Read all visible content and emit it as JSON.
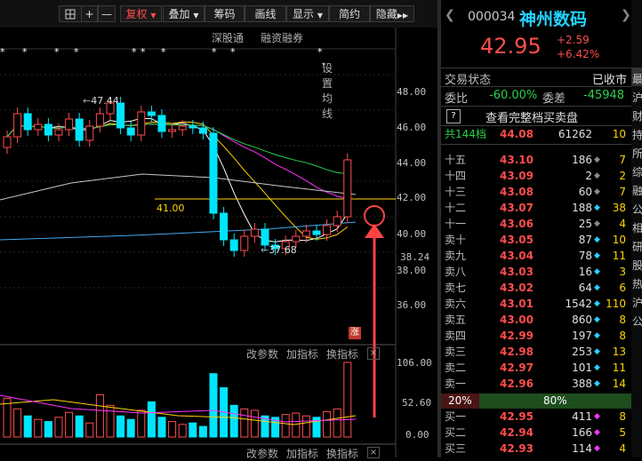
{
  "toolbar": {
    "plus": "+",
    "minus": "—",
    "fuquan": "复权",
    "diejia": "叠加",
    "chouma": "筹码",
    "huaxian": "画线",
    "xianshi": "显示",
    "jianyue": "简约",
    "yincang": "隐藏"
  },
  "sublinks": {
    "shengutong": "深股通",
    "rongzi": "融资融券",
    "junxian": "设置均线"
  },
  "price_axis": [
    "48.00",
    "46.00",
    "44.00",
    "42.00",
    "40.00",
    "38.24",
    "38.00",
    "36.00"
  ],
  "annotations": {
    "high": "47.44",
    "low": "37.68",
    "ref_price": "41.00",
    "zhang": "涨"
  },
  "indicator_bar": {
    "gaicanshu": "改参数",
    "jiazhibiao": "加指标",
    "huanzhibiao": "换指标",
    "close": "×"
  },
  "volume_axis": [
    "106.00",
    "52.60",
    "0.00"
  ],
  "chart_data": {
    "type": "candlestick",
    "close_series": [
      44.5,
      45.8,
      44.9,
      45.2,
      44.6,
      44.9,
      45.5,
      44.3,
      45.1,
      45.8,
      46.4,
      45.0,
      44.6,
      45.9,
      45.7,
      44.8,
      44.9,
      45.1,
      45.0,
      44.7,
      40.2,
      38.7,
      38.1,
      38.9,
      39.3,
      38.4,
      38.2,
      38.6,
      38.9,
      39.2,
      39.0,
      39.5,
      40.0,
      43.2
    ],
    "volume_series": [
      55,
      40,
      30,
      25,
      22,
      28,
      35,
      30,
      20,
      60,
      45,
      30,
      25,
      38,
      50,
      28,
      22,
      18,
      20,
      15,
      90,
      70,
      45,
      40,
      38,
      30,
      28,
      32,
      34,
      30,
      28,
      36,
      40,
      106
    ],
    "ylim": [
      35.2,
      49.0
    ],
    "vol_ylim": [
      0,
      106
    ]
  },
  "quote": {
    "code": "000034",
    "name": "神州数码",
    "price": "42.95",
    "change": "+2.59",
    "change_pct": "+6.42%",
    "status_label": "交易状态",
    "status": "已收市",
    "weibi_label": "委比",
    "weibi": "-60.00%",
    "weicha_label": "委差",
    "weicha": "-45948",
    "help": "?",
    "full_book": "查看完整档买卖盘",
    "total_label": "共144档",
    "total_price": "44.08",
    "total_vol": "61262",
    "total_count": "10"
  },
  "asks": [
    {
      "label": "十五",
      "price": "43.10",
      "vol": "186",
      "count": "7"
    },
    {
      "label": "十四",
      "price": "43.09",
      "vol": "2",
      "count": "2"
    },
    {
      "label": "十三",
      "price": "43.08",
      "vol": "60",
      "count": "7"
    },
    {
      "label": "十二",
      "price": "43.07",
      "vol": "188",
      "count": "38"
    },
    {
      "label": "十一",
      "price": "43.06",
      "vol": "25",
      "count": "4"
    },
    {
      "label": "卖十",
      "price": "43.05",
      "vol": "87",
      "count": "10"
    },
    {
      "label": "卖九",
      "price": "43.04",
      "vol": "78",
      "count": "11"
    },
    {
      "label": "卖八",
      "price": "43.03",
      "vol": "16",
      "count": "3"
    },
    {
      "label": "卖七",
      "price": "43.02",
      "vol": "64",
      "count": "6"
    },
    {
      "label": "卖六",
      "price": "43.01",
      "vol": "1542",
      "count": "110"
    },
    {
      "label": "卖五",
      "price": "43.00",
      "vol": "860",
      "count": "8"
    },
    {
      "label": "卖四",
      "price": "42.99",
      "vol": "197",
      "count": "8"
    },
    {
      "label": "卖三",
      "price": "42.98",
      "vol": "253",
      "count": "13"
    },
    {
      "label": "卖二",
      "price": "42.97",
      "vol": "101",
      "count": "11"
    },
    {
      "label": "卖一",
      "price": "42.96",
      "vol": "388",
      "count": "14"
    }
  ],
  "ratio": {
    "left": "20%",
    "right": "80%"
  },
  "bids": [
    {
      "label": "买一",
      "price": "42.95",
      "vol": "411",
      "count": "8"
    },
    {
      "label": "买二",
      "price": "42.94",
      "vol": "166",
      "count": "5"
    },
    {
      "label": "买三",
      "price": "42.93",
      "vol": "114",
      "count": "4"
    }
  ],
  "edge_text": [
    "最",
    "沪",
    "财",
    "持",
    "所",
    "综",
    "融",
    "公",
    "相",
    "研",
    "股",
    "热",
    "沪",
    "公"
  ],
  "colors": {
    "up": "#ff4d4d",
    "down": "#00ffff",
    "green": "#29d148",
    "yellow": "#ffd400",
    "name": "#22d3ff"
  }
}
